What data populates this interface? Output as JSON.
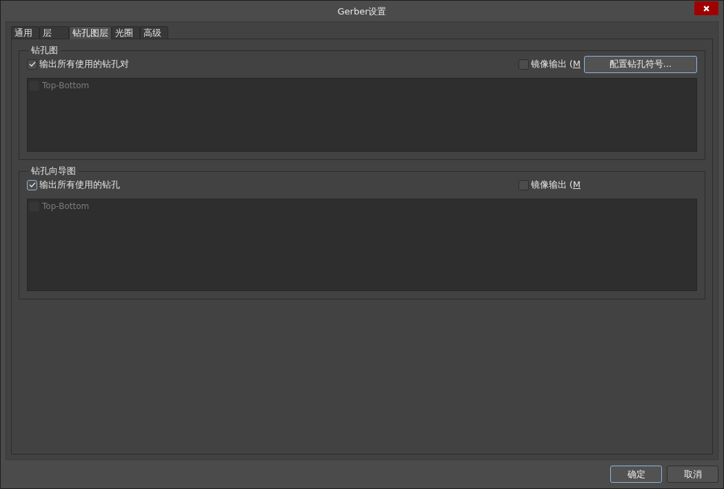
{
  "window": {
    "title": "Gerber设置"
  },
  "tabs": [
    {
      "label": "通用",
      "selected": false
    },
    {
      "label": "层",
      "selected": false
    },
    {
      "label": "钻孔图层",
      "selected": true
    },
    {
      "label": "光圈",
      "selected": false
    },
    {
      "label": "高级",
      "selected": false
    }
  ],
  "groups": [
    {
      "title": "钻孔图",
      "output_all": {
        "label": "输出所有使用的钻孔对",
        "checked": true,
        "focused": false
      },
      "mirror": {
        "label": "镜像输出 (",
        "mnemonic": "M",
        "checked": false
      },
      "button": {
        "label": "配置钻孔符号...",
        "highlighted": true
      },
      "pairs": [
        {
          "label": "Top-Bottom",
          "checked": false,
          "disabled": true
        }
      ]
    },
    {
      "title": "钻孔向导图",
      "output_all": {
        "label": "输出所有使用的钻孔",
        "checked": true,
        "focused": true
      },
      "mirror": {
        "label": "镜像输出 (",
        "mnemonic": "M",
        "checked": false
      },
      "pairs": [
        {
          "label": "Top-Bottom",
          "checked": false,
          "disabled": true
        }
      ]
    }
  ],
  "buttons": [
    {
      "label": "确定",
      "highlighted": true
    },
    {
      "label": "取消",
      "highlighted": false
    }
  ]
}
